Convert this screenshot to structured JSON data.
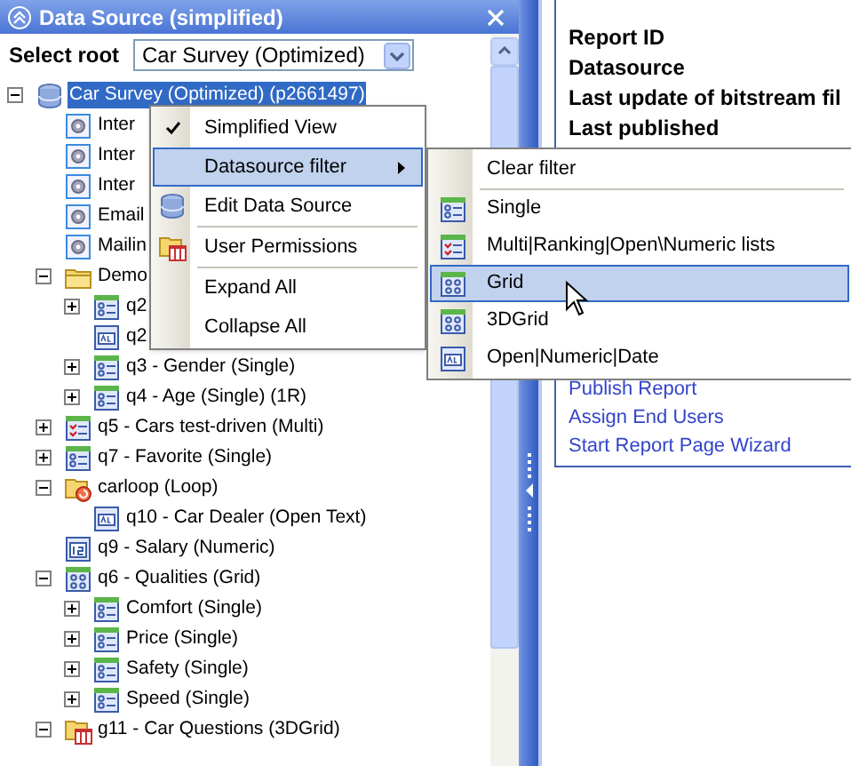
{
  "panel": {
    "title": "Data Source (simplified)"
  },
  "select_root": {
    "label": "Select root",
    "value": "Car Survey (Optimized)"
  },
  "tree": [
    {
      "label": "Car Survey (Optimized) (p2661497)",
      "kind": "database",
      "expanded": true,
      "selected": true,
      "children": [
        {
          "label": "Inter",
          "kind": "settings",
          "selected": false
        },
        {
          "label": "Inter",
          "kind": "settings",
          "selected": false
        },
        {
          "label": "Inter",
          "kind": "settings",
          "selected": false
        },
        {
          "label": "Email",
          "kind": "settings",
          "selected": false
        },
        {
          "label": "Mailin",
          "kind": "settings",
          "selected": false
        },
        {
          "label": "Demo",
          "kind": "folder",
          "expanded": true,
          "selected": false,
          "children": [
            {
              "label": "q2",
              "kind": "single",
              "expanded": false,
              "selected": false
            },
            {
              "label": "q2",
              "kind": "text",
              "selected": false
            },
            {
              "label": "q3 - Gender (Single)",
              "kind": "single",
              "expanded": false,
              "selected": false
            },
            {
              "label": "q4 - Age (Single) (1R)",
              "kind": "single",
              "expanded": false,
              "selected": false
            }
          ]
        },
        {
          "label": "q5 - Cars test-driven (Multi)",
          "kind": "multi",
          "expanded": false,
          "selected": false
        },
        {
          "label": "q7 - Favorite (Single)",
          "kind": "single",
          "expanded": false,
          "selected": false
        },
        {
          "label": "carloop (Loop)",
          "kind": "loop",
          "expanded": true,
          "selected": false,
          "children": [
            {
              "label": "q10 - Car Dealer (Open Text)",
              "kind": "text",
              "selected": false
            }
          ]
        },
        {
          "label": "q9 - Salary (Numeric)",
          "kind": "numeric",
          "selected": false
        },
        {
          "label": "q6 - Qualities (Grid)",
          "kind": "grid",
          "expanded": true,
          "selected": false,
          "children": [
            {
              "label": "Comfort (Single)",
              "kind": "single",
              "expanded": false,
              "selected": false
            },
            {
              "label": "Price (Single)",
              "kind": "single",
              "expanded": false,
              "selected": false
            },
            {
              "label": "Safety (Single)",
              "kind": "single",
              "expanded": false,
              "selected": false
            },
            {
              "label": "Speed (Single)",
              "kind": "single",
              "expanded": false,
              "selected": false
            }
          ]
        },
        {
          "label": "g11 - Car Questions (3DGrid)",
          "kind": "folder-grid",
          "expanded": true,
          "selected": false
        }
      ]
    }
  ],
  "report": {
    "fields": [
      "Report ID",
      "Datasource",
      "Last update of bitstream fil",
      "Last published"
    ],
    "links": [
      "Publish Report",
      "Assign End Users",
      "Start Report Page Wizard"
    ]
  },
  "context_menu": {
    "items": [
      {
        "kind": "check",
        "label": "Simplified View",
        "checked": true,
        "selected": false
      },
      {
        "kind": "submenu",
        "label": "Datasource filter",
        "selected": true
      },
      {
        "kind": "database",
        "label": "Edit Data Source",
        "selected": false
      },
      {
        "kind": "separator"
      },
      {
        "kind": "folder-grid",
        "label": "User Permissions",
        "selected": false
      },
      {
        "kind": "separator"
      },
      {
        "kind": "plain",
        "label": "Expand All",
        "selected": false
      },
      {
        "kind": "plain",
        "label": "Collapse All",
        "selected": false
      }
    ]
  },
  "submenu": {
    "items": [
      {
        "kind": "plain",
        "label": "Clear filter",
        "selected": false
      },
      {
        "kind": "separator"
      },
      {
        "kind": "single",
        "label": "Single",
        "selected": false
      },
      {
        "kind": "multi",
        "label": "Multi|Ranking|Open\\Numeric lists",
        "selected": false
      },
      {
        "kind": "grid",
        "label": "Grid",
        "selected": true
      },
      {
        "kind": "grid",
        "label": "3DGrid",
        "selected": false
      },
      {
        "kind": "text",
        "label": "Open|Numeric|Date",
        "selected": false
      }
    ]
  }
}
